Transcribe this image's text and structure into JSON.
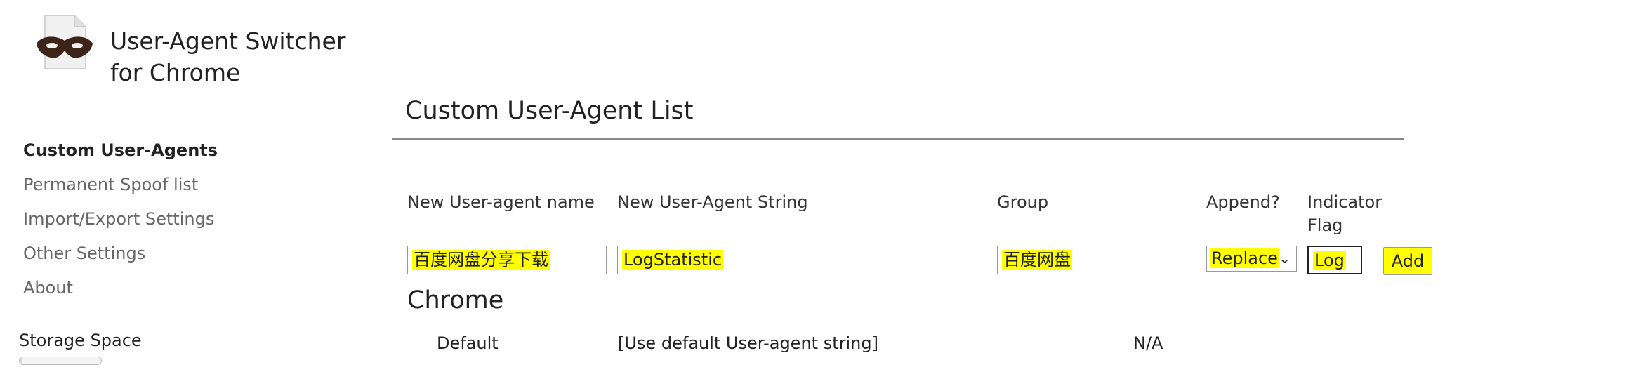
{
  "app": {
    "title_line1": "User-Agent Switcher",
    "title_line2": "for Chrome"
  },
  "nav": {
    "items": [
      {
        "label": "Custom User-Agents",
        "active": true
      },
      {
        "label": "Permanent Spoof list",
        "active": false
      },
      {
        "label": "Import/Export Settings",
        "active": false
      },
      {
        "label": "Other Settings",
        "active": false
      },
      {
        "label": "About",
        "active": false
      }
    ]
  },
  "storage": {
    "label": "Storage Space",
    "used_fraction": 0.03
  },
  "main": {
    "title": "Custom User-Agent List",
    "form": {
      "name_label": "New User-agent name",
      "string_label": "New User-Agent String",
      "group_label": "Group",
      "append_label": "Append?",
      "flag_label_line1": "Indicator",
      "flag_label_line2": "Flag",
      "name_value": "百度网盘分享下载",
      "string_value": "LogStatistic",
      "group_value": "百度网盘",
      "append_value": "Replace",
      "flag_value": "Log",
      "add_label": "Add"
    },
    "section": {
      "title": "Chrome",
      "rows": [
        {
          "name": "Default",
          "string": "[Use default User-agent string]",
          "flag": "N/A"
        }
      ]
    }
  },
  "highlight_color": "#ffff00"
}
